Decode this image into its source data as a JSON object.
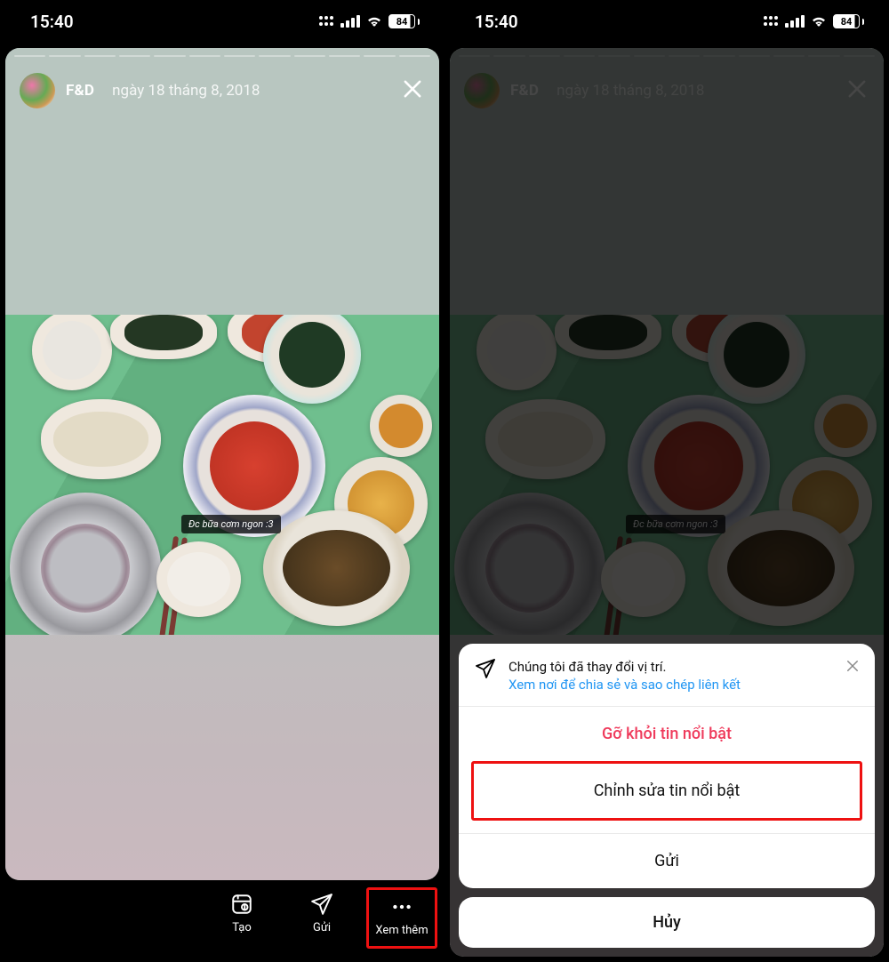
{
  "status": {
    "time": "15:40",
    "battery": "84"
  },
  "story": {
    "title": "F&D",
    "date": "ngày 18 tháng 8, 2018",
    "segments": 12,
    "caption": "Đc bữa cơm ngon :3"
  },
  "toolbar": {
    "create": "Tạo",
    "send": "Gửi",
    "more": "Xem thêm"
  },
  "sheet": {
    "notice_line1": "Chúng tôi đã thay đổi vị trí.",
    "notice_link": "Xem nơi để chia sẻ và sao chép liên kết",
    "remove": "Gỡ khỏi tin nổi bật",
    "edit": "Chỉnh sửa tin nổi bật",
    "send": "Gửi",
    "cancel": "Hủy"
  }
}
